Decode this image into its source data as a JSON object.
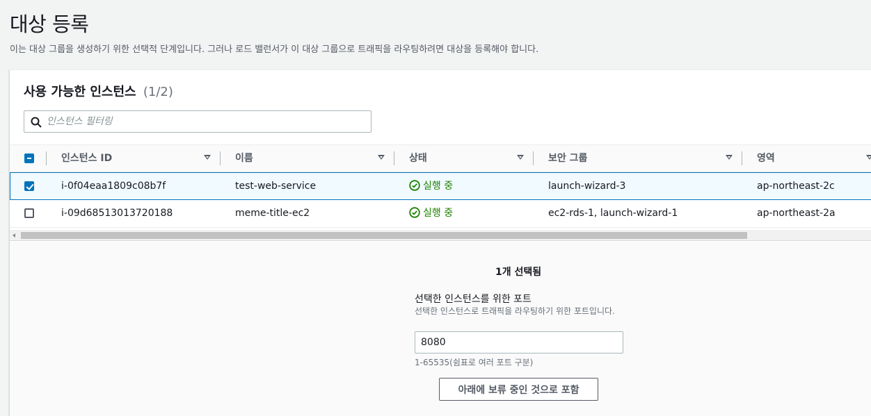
{
  "page": {
    "title": "대상 등록",
    "description": "이는 대상 그룹을 생성하기 위한 선택적 단계입니다. 그러나 로드 밸런서가 이 대상 그룹으로 트래픽을 라우팅하려면 대상을 등록해야 합니다."
  },
  "instances_panel": {
    "title": "사용 가능한 인스턴스",
    "count": "(1/2)",
    "filter_placeholder": "인스턴스 필터링",
    "columns": [
      "인스턴스 ID",
      "이름",
      "상태",
      "보안 그룹",
      "영역"
    ],
    "rows": [
      {
        "selected": true,
        "instance_id": "i-0f04eaa1809c08b7f",
        "name": "test-web-service",
        "state": "실행 중",
        "security_groups": "launch-wizard-3",
        "zone": "ap-northeast-2c"
      },
      {
        "selected": false,
        "instance_id": "i-09d68513013720188",
        "name": "meme-title-ec2",
        "state": "실행 중",
        "security_groups": "ec2-rds-1, launch-wizard-1",
        "zone": "ap-northeast-2a"
      }
    ]
  },
  "selection": {
    "count_label": "1개 선택됨",
    "port_label": "선택한 인스턴스를 위한 포트",
    "port_description": "선택한 인스턴스로 트래픽을 라우팅하기 위한 포트입니다.",
    "port_value": "8080",
    "port_hint": "1-65535(쉼표로 여러 포트 구분)",
    "include_button": "아래에 보류 중인 것으로 포함"
  },
  "colors": {
    "accent": "#0073bb",
    "running": "#1d8102"
  }
}
